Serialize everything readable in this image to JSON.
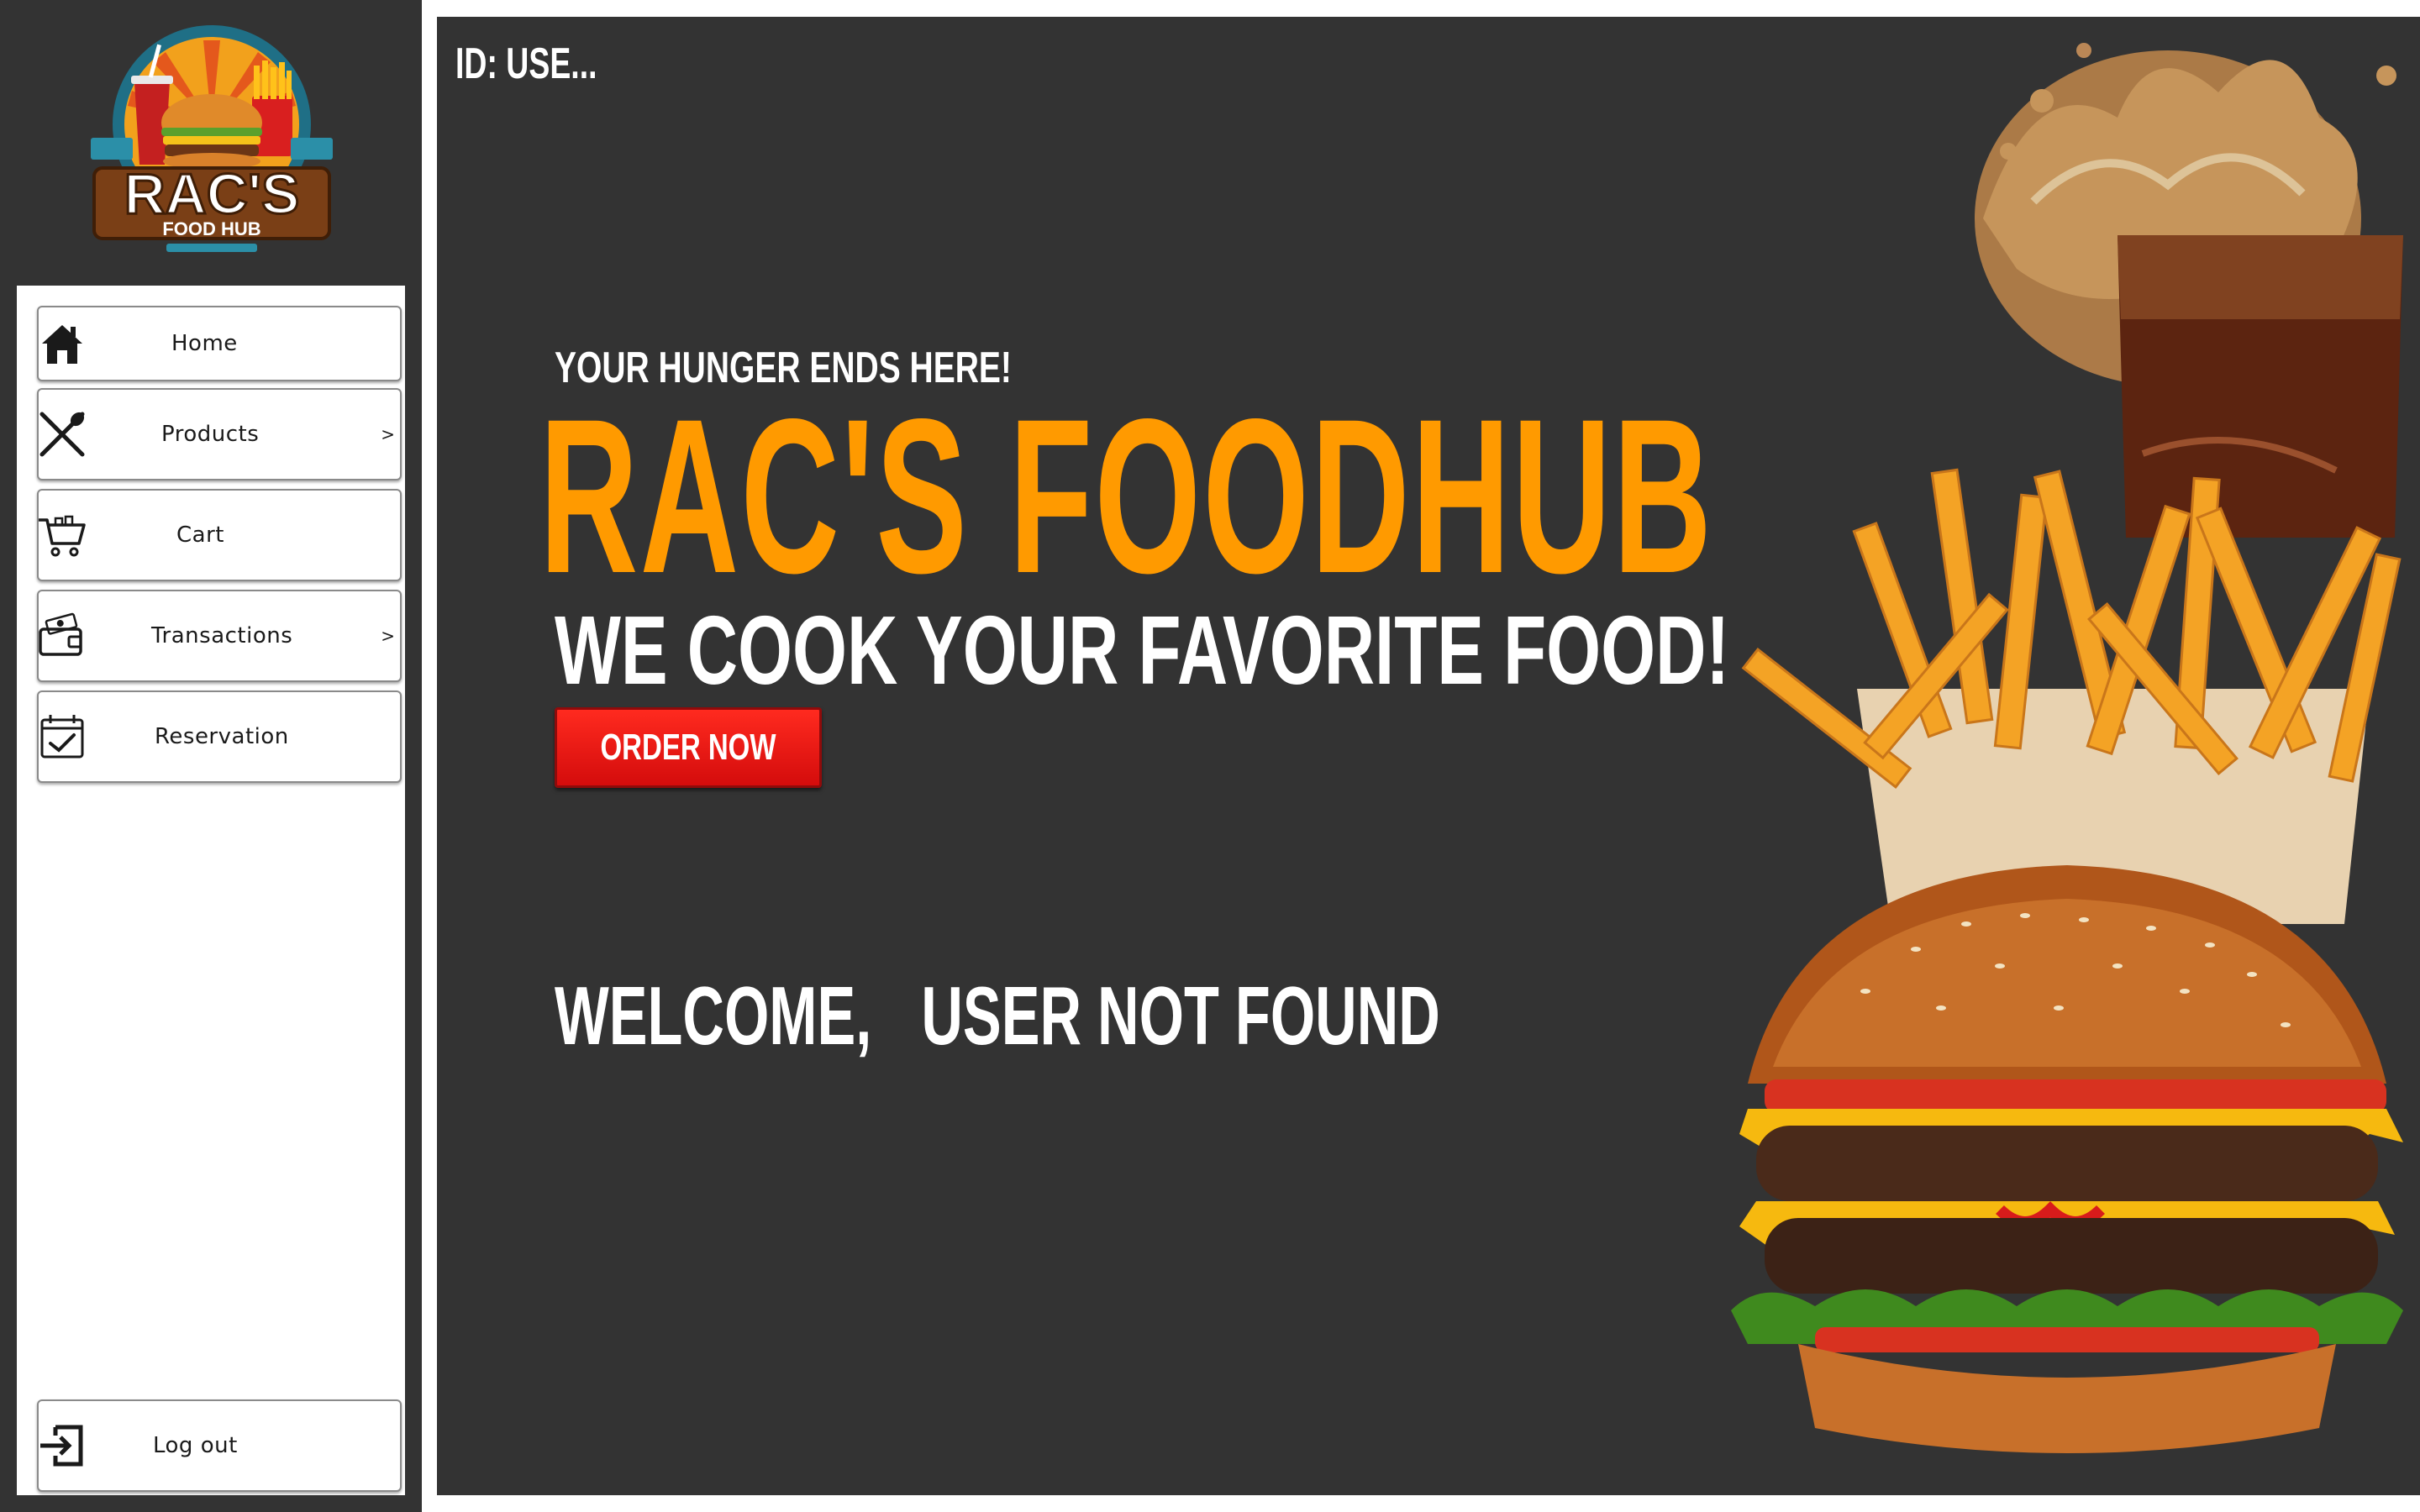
{
  "app": {
    "logo_text": "RAC'S",
    "logo_subtext": "FOOD HUB"
  },
  "sidebar": {
    "items": [
      {
        "label": "Home",
        "icon": "home-icon",
        "has_submenu": false
      },
      {
        "label": "Products",
        "icon": "fork-spoon-icon",
        "has_submenu": true
      },
      {
        "label": "Cart",
        "icon": "cart-icon",
        "has_submenu": false
      },
      {
        "label": "Transactions",
        "icon": "wallet-icon",
        "has_submenu": true
      },
      {
        "label": "Reservation",
        "icon": "calendar-check-icon",
        "has_submenu": false
      }
    ],
    "submenu_indicator": ">",
    "logout": {
      "label": "Log out",
      "icon": "logout-icon"
    }
  },
  "main": {
    "user_id": "ID: USE...",
    "tagline": "YOUR HUNGER ENDS HERE!",
    "brand_title": "RAC'S FOODHUB",
    "subtitle": "WE COOK YOUR FAVORITE FOOD!",
    "order_button": "ORDER NOW",
    "welcome_prefix": "WELCOME,",
    "welcome_user": "USER NOT FOUND"
  },
  "colors": {
    "background": "#333333",
    "accent": "#ff9a00",
    "order_button": "#e51515",
    "panel": "#ffffff"
  }
}
